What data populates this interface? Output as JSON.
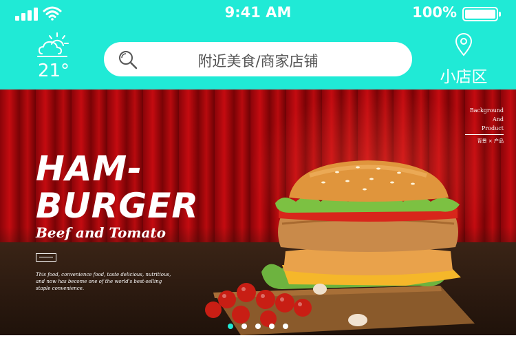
{
  "status_bar": {
    "time": "9:41 AM",
    "battery_percent": "100%"
  },
  "header": {
    "temperature": "21°",
    "search_placeholder": "附近美食/商家店铺",
    "location_label": "小店区"
  },
  "banner": {
    "title_line1": "HAM-",
    "title_line2": "BURGER",
    "subtitle": "Beef and Tomato",
    "description": "This food, convenience food, taste delicious, nutritious, and now has become one of the world's best-selling staple convenience.",
    "top_right_lines": [
      "Background",
      "And",
      "Product"
    ],
    "top_right_sub": "背景 × 产品",
    "slide_count": 5,
    "active_slide": 1
  },
  "colors": {
    "accent": "#20ead6",
    "banner_red": "#c40b10"
  }
}
